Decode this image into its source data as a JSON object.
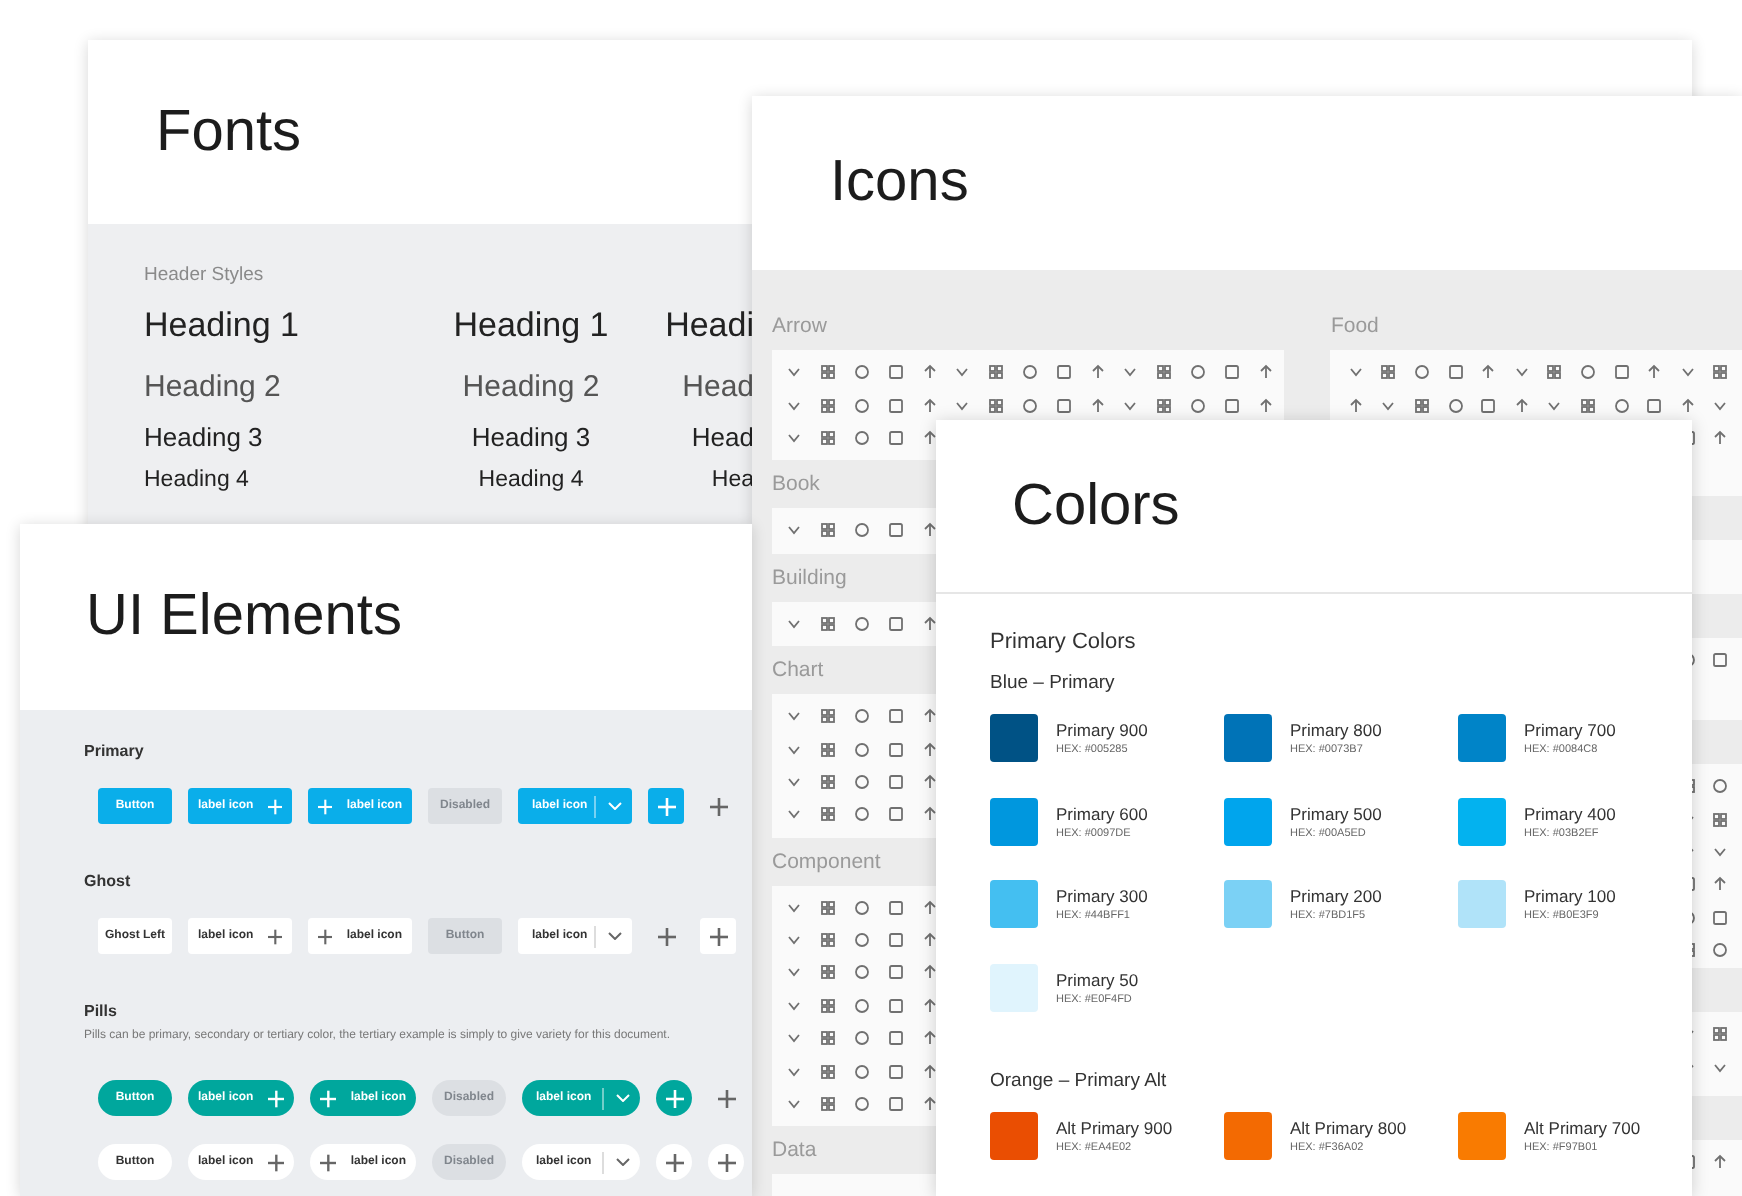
{
  "fonts": {
    "title": "Fonts",
    "section": "Header Styles",
    "columns": [
      {
        "headings": [
          "Heading 1",
          "Heading 2",
          "Heading 3",
          "Heading 4"
        ]
      },
      {
        "headings": [
          "Heading 1",
          "Heading 2",
          "Heading 3",
          "Heading 4"
        ]
      },
      {
        "headings": [
          "Headi",
          "Head",
          "Head",
          "Hea"
        ]
      }
    ]
  },
  "icons": {
    "title": "Icons",
    "columns": [
      {
        "sections": [
          {
            "title": "Arrow"
          },
          {
            "title": "Book"
          },
          {
            "title": "Building"
          },
          {
            "title": "Chart"
          },
          {
            "title": "Component"
          },
          {
            "title": "Data"
          }
        ]
      },
      {
        "sections": [
          {
            "title": "Food"
          }
        ]
      }
    ]
  },
  "ui_elements": {
    "title": "UI Elements",
    "groups": [
      {
        "title": "Primary",
        "rows": [
          {
            "buttons": [
              {
                "kind": "text",
                "label": "Button",
                "disabled": false
              },
              {
                "kind": "icon-right",
                "label": "label icon",
                "disabled": false
              },
              {
                "kind": "icon-left",
                "label": "label icon",
                "disabled": false
              },
              {
                "kind": "text",
                "label": "Disabled",
                "disabled": true
              },
              {
                "kind": "split",
                "label": "label icon",
                "disabled": false
              },
              {
                "kind": "icon",
                "disabled": false
              },
              {
                "kind": "bare-icon",
                "disabled": false
              }
            ]
          }
        ]
      },
      {
        "title": "Ghost",
        "rows": [
          {
            "buttons": [
              {
                "kind": "text",
                "label": "Ghost Left",
                "disabled": false
              },
              {
                "kind": "icon-right",
                "label": "label icon",
                "disabled": false
              },
              {
                "kind": "icon-left",
                "label": "label icon",
                "disabled": false
              },
              {
                "kind": "text",
                "label": "Button",
                "disabled": true
              },
              {
                "kind": "split",
                "label": "label icon",
                "disabled": false
              },
              {
                "kind": "bare-icon",
                "disabled": false
              },
              {
                "kind": "icon",
                "disabled": false
              }
            ]
          }
        ]
      },
      {
        "title": "Pills",
        "description": "Pills can be primary, secondary or tertiary color, the tertiary example is simply to give variety for this document.",
        "rows": [
          {
            "buttons": [
              {
                "kind": "text",
                "label": "Button",
                "disabled": false
              },
              {
                "kind": "icon-right",
                "label": "label icon",
                "disabled": false
              },
              {
                "kind": "icon-left",
                "label": "label icon",
                "disabled": false
              },
              {
                "kind": "text",
                "label": "Disabled",
                "disabled": true
              },
              {
                "kind": "split",
                "label": "label icon",
                "disabled": false
              },
              {
                "kind": "icon",
                "disabled": false
              },
              {
                "kind": "bare-icon",
                "disabled": false
              }
            ]
          },
          {
            "buttons": [
              {
                "kind": "text",
                "label": "Button",
                "disabled": false
              },
              {
                "kind": "icon-right",
                "label": "label icon",
                "disabled": false
              },
              {
                "kind": "icon-left",
                "label": "label icon",
                "disabled": false
              },
              {
                "kind": "text",
                "label": "Disabled",
                "disabled": true
              },
              {
                "kind": "split",
                "label": "label icon",
                "disabled": false
              },
              {
                "kind": "icon",
                "disabled": false
              },
              {
                "kind": "icon",
                "disabled": false
              }
            ]
          }
        ]
      }
    ]
  },
  "colors": {
    "title": "Colors",
    "section": "Primary Colors",
    "groups": [
      {
        "title": "Blue – Primary",
        "swatches": [
          {
            "name": "Primary 900",
            "hex": "HEX: #005285",
            "color": "#005285"
          },
          {
            "name": "Primary 800",
            "hex": "HEX: #0073B7",
            "color": "#0073b7"
          },
          {
            "name": "Primary 700",
            "hex": "HEX: #0084C8",
            "color": "#0084c8"
          },
          {
            "name": "Primary 600",
            "hex": "HEX: #0097DE",
            "color": "#0097de"
          },
          {
            "name": "Primary 500",
            "hex": "HEX: #00A5ED",
            "color": "#00a5ed"
          },
          {
            "name": "Primary 400",
            "hex": "HEX: #03B2EF",
            "color": "#03b2ef"
          },
          {
            "name": "Primary 300",
            "hex": "HEX: #44BFF1",
            "color": "#44bff1"
          },
          {
            "name": "Primary 200",
            "hex": "HEX: #7BD1F5",
            "color": "#7bd1f5"
          },
          {
            "name": "Primary 100",
            "hex": "HEX: #B0E3F9",
            "color": "#b0e3f9"
          },
          {
            "name": "Primary 50",
            "hex": "HEX: #E0F4FD",
            "color": "#e0f4fd"
          }
        ]
      },
      {
        "title": "Orange – Primary Alt",
        "swatches": [
          {
            "name": "Alt Primary 900",
            "hex": "HEX: #EA4E02",
            "color": "#ea4e02"
          },
          {
            "name": "Alt Primary 800",
            "hex": "HEX: #F36A02",
            "color": "#f36a02"
          },
          {
            "name": "Alt Primary 700",
            "hex": "HEX: #F97B01",
            "color": "#f97b01"
          }
        ]
      }
    ]
  }
}
